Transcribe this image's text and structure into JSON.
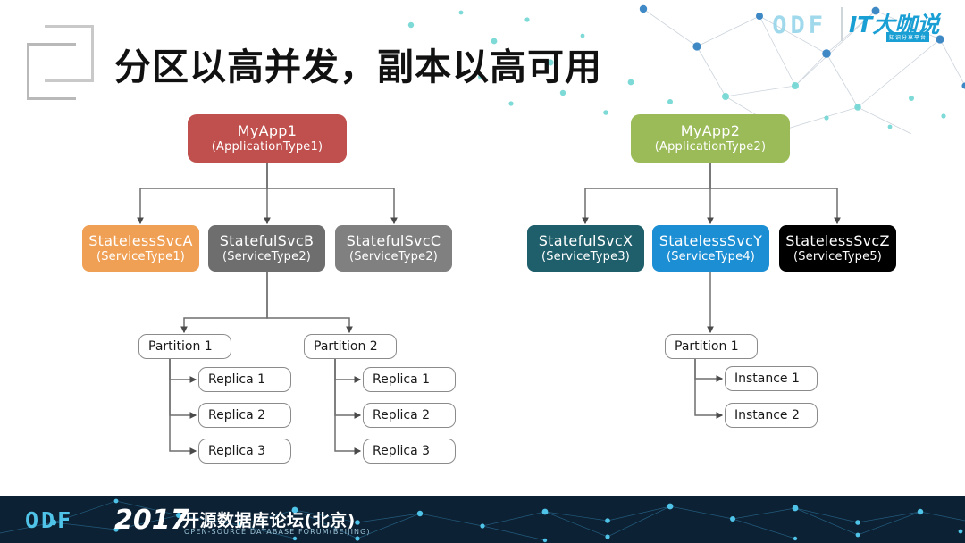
{
  "header": {
    "title": "分区以高并发，副本以高可用",
    "logo_mark": "overlapping-squares-logo",
    "brand_odf": "ODF",
    "brand_it_main": "IT大咖说",
    "brand_it_sub": "知识分享平台"
  },
  "colors": {
    "app1": "#c0504d",
    "app2": "#9bbb59",
    "svc_a": "#f0a055",
    "svc_b": "#6e6e6e",
    "svc_c": "#808080",
    "svc_x": "#1f5f6b",
    "svc_y": "#1b8ed4",
    "svc_z": "#000000",
    "connector": "#6f6f6f",
    "plain_border": "#8b8b8b",
    "footer_bg": "#0c2133",
    "accent_cyan": "#4fc3e8"
  },
  "diagram": {
    "apps": [
      {
        "id": "myapp1",
        "name": "MyApp1",
        "type": "(ApplicationType1)",
        "color": "#c0504d"
      },
      {
        "id": "myapp2",
        "name": "MyApp2",
        "type": "(ApplicationType2)",
        "color": "#9bbb59"
      }
    ],
    "services": [
      {
        "id": "stateless-svc-a",
        "name": "StatelessSvcA",
        "type": "(ServiceType1)",
        "color": "#f0a055"
      },
      {
        "id": "stateful-svc-b",
        "name": "StatefulSvcB",
        "type": "(ServiceType2)",
        "color": "#6e6e6e"
      },
      {
        "id": "stateful-svc-c",
        "name": "StatefulSvcC",
        "type": "(ServiceType2)",
        "color": "#808080"
      },
      {
        "id": "stateful-svc-x",
        "name": "StatefulSvcX",
        "type": "(ServiceType3)",
        "color": "#1f5f6b"
      },
      {
        "id": "stateless-svc-y",
        "name": "StatelessSvcY",
        "type": "(ServiceType4)",
        "color": "#1b8ed4"
      },
      {
        "id": "stateless-svc-z",
        "name": "StatelessSvcZ",
        "type": "(ServiceType5)",
        "color": "#000000"
      }
    ],
    "partitions": [
      {
        "id": "left-partition-1",
        "label": "Partition 1"
      },
      {
        "id": "left-partition-2",
        "label": "Partition 2"
      },
      {
        "id": "right-partition-1",
        "label": "Partition 1"
      }
    ],
    "replicas_p1": [
      {
        "label": "Replica 1"
      },
      {
        "label": "Replica 2"
      },
      {
        "label": "Replica 3"
      }
    ],
    "replicas_p2": [
      {
        "label": "Replica 1"
      },
      {
        "label": "Replica 2"
      },
      {
        "label": "Replica 3"
      }
    ],
    "instances": [
      {
        "label": "Instance 1"
      },
      {
        "label": "Instance 2"
      }
    ]
  },
  "footer": {
    "odf": "ODF",
    "year": "2017",
    "title_cn": "开源数据库论坛(北京)",
    "title_en": "OPEN-SOURCE DATABASE FORUM(BEIJING)"
  }
}
